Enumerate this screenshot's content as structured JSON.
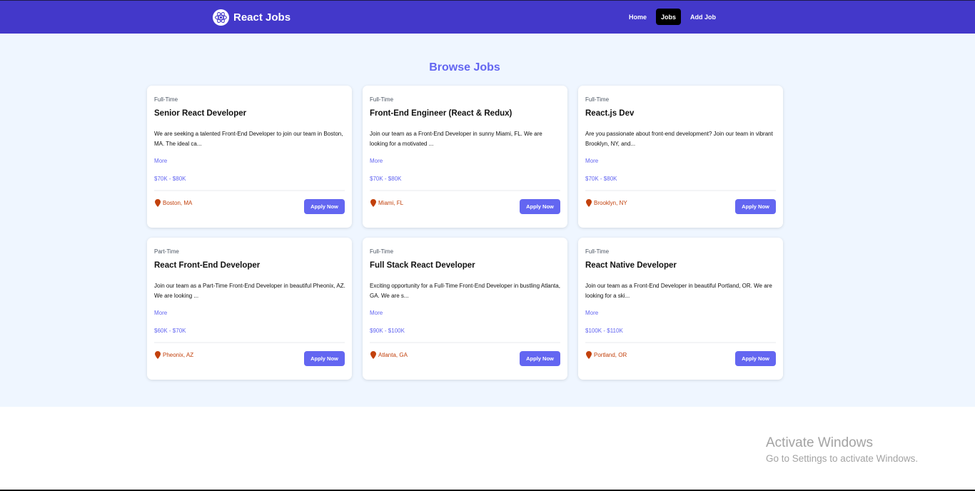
{
  "navbar": {
    "brand": "React Jobs",
    "links": [
      {
        "label": "Home",
        "active": false
      },
      {
        "label": "Jobs",
        "active": true
      },
      {
        "label": "Add Job",
        "active": false
      }
    ],
    "color": "#4338ca"
  },
  "browse": {
    "title": "Browse Jobs",
    "jobs": [
      {
        "type": "Full-Time",
        "title": "Senior React Developer",
        "description": "We are seeking a talented Front-End Developer to join our team in Boston, MA. The ideal ca...",
        "more": "More",
        "salary": "$70K - $80K",
        "location": "Boston, MA",
        "apply": "Apply Now"
      },
      {
        "type": "Full-Time",
        "title": "Front-End Engineer (React & Redux)",
        "description": "Join our team as a Front-End Developer in sunny Miami, FL. We are looking for a motivated ...",
        "more": "More",
        "salary": "$70K - $80K",
        "location": "Miami, FL",
        "apply": "Apply Now"
      },
      {
        "type": "Full-Time",
        "title": "React.js Dev",
        "description": "Are you passionate about front-end development? Join our team in vibrant Brooklyn, NY, and...",
        "more": "More",
        "salary": "$70K - $80K",
        "location": "Brooklyn, NY",
        "apply": "Apply Now"
      },
      {
        "type": "Part-Time",
        "title": "React Front-End Developer",
        "description": "Join our team as a Part-Time Front-End Developer in beautiful Pheonix, AZ. We are looking ...",
        "more": "More",
        "salary": "$60K - $70K",
        "location": "Pheonix, AZ",
        "apply": "Apply Now"
      },
      {
        "type": "Full-Time",
        "title": "Full Stack React Developer",
        "description": "Exciting opportunity for a Full-Time Front-End Developer in bustling Atlanta, GA. We are s...",
        "more": "More",
        "salary": "$90K - $100K",
        "location": "Atlanta, GA",
        "apply": "Apply Now"
      },
      {
        "type": "Full-Time",
        "title": "React Native Developer",
        "description": "Join our team as a Front-End Developer in beautiful Portland, OR. We are looking for a ski...",
        "more": "More",
        "salary": "$100K - $110K",
        "location": "Portland, OR",
        "apply": "Apply Now"
      }
    ]
  },
  "watermark": {
    "title": "Activate Windows",
    "subtitle": "Go to Settings to activate Windows."
  },
  "colors": {
    "accent": "#6366f1",
    "location": "#c2410c",
    "background": "#eff6ff"
  }
}
